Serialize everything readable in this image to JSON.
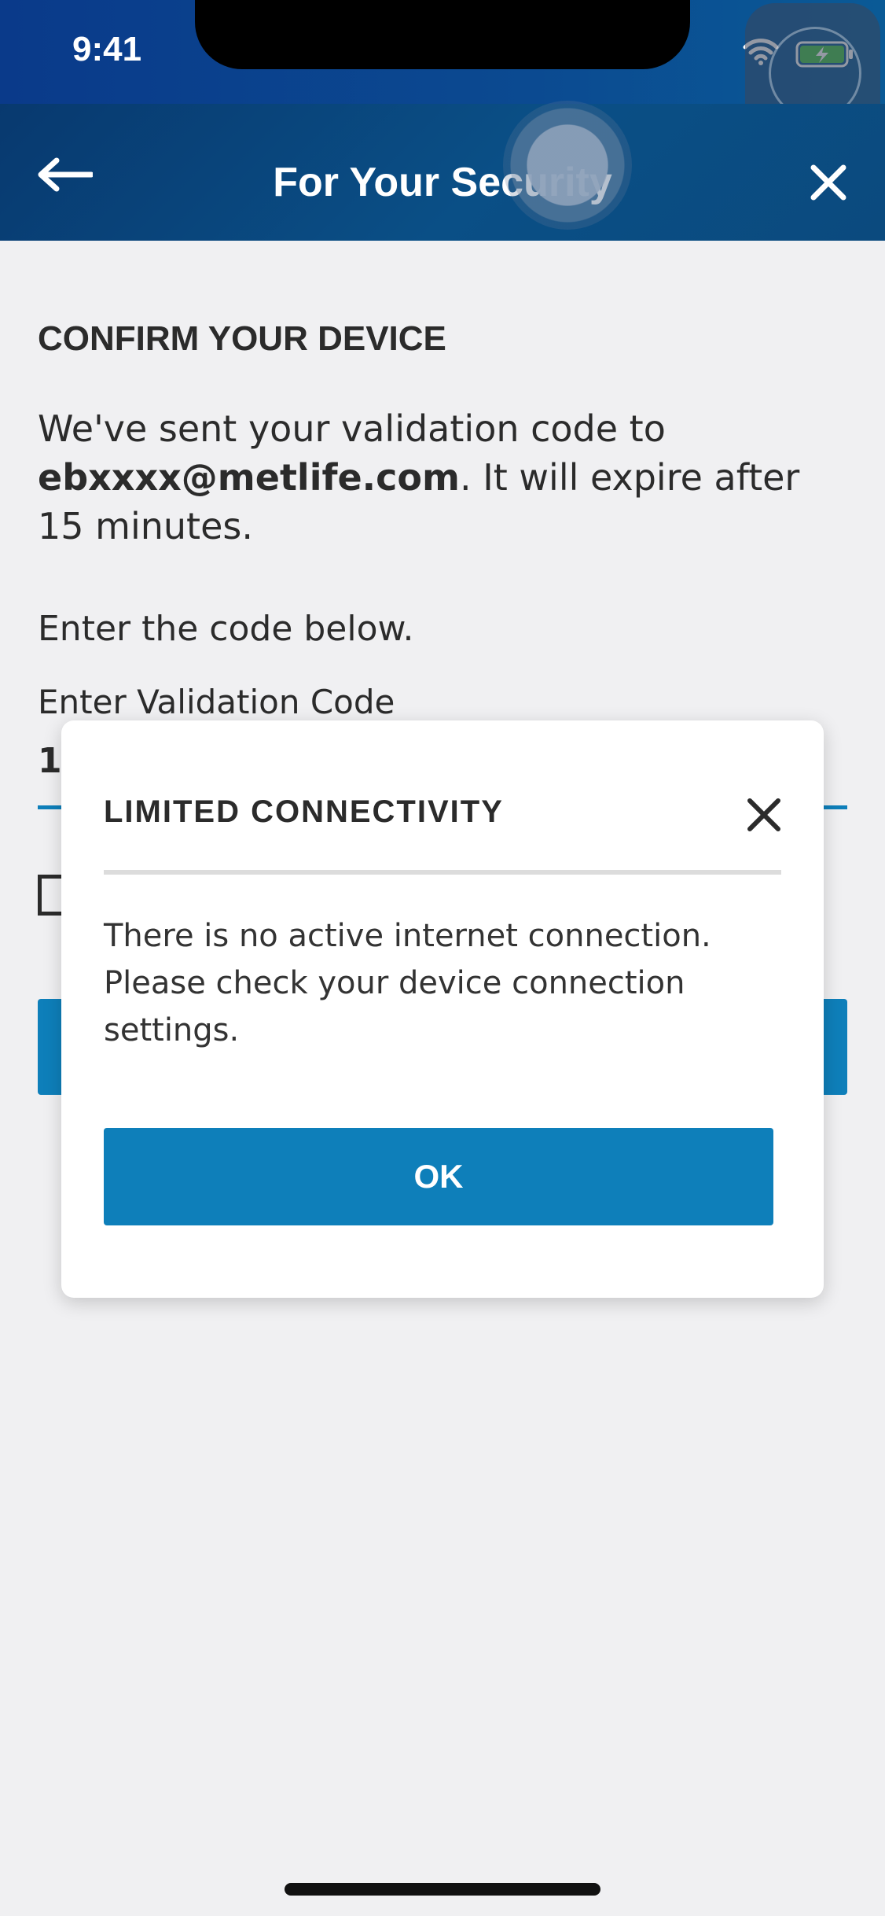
{
  "status_bar": {
    "time": "9:41",
    "icons": [
      "wifi-icon",
      "battery-charging-icon"
    ]
  },
  "header": {
    "title": "For Your Security",
    "back_icon": "arrow-left-icon",
    "close_icon": "close-icon",
    "background_color": "#0a4a80"
  },
  "content": {
    "heading": "CONFIRM YOUR DEVICE",
    "intro_prefix": "We've sent your validation code to ",
    "email": "ebxxxx@metlife.com",
    "intro_suffix": ". It will expire after 15 minutes.",
    "instruction": "Enter the code below.",
    "field_label": "Enter Validation Code",
    "field_value": "1",
    "accent_color": "#0e7fba"
  },
  "modal": {
    "title": "LIMITED CONNECTIVITY",
    "body": "There is no active internet connection. Please check your device connection settings.",
    "ok_label": "OK",
    "close_icon": "close-icon"
  }
}
